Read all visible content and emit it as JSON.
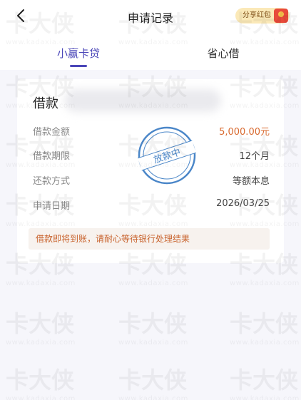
{
  "header": {
    "title": "申请记录",
    "share_label": "分享红包"
  },
  "tabs": [
    {
      "label": "小赢卡贷",
      "active": true
    },
    {
      "label": "省心借",
      "active": false
    }
  ],
  "card": {
    "title": "借款",
    "rows": [
      {
        "label": "借款金额",
        "value": "5,000.00元"
      },
      {
        "label": "借款期限",
        "value": "12个月"
      },
      {
        "label": "还款方式",
        "value": "等额本息"
      },
      {
        "label": "申请日期",
        "value": "2026/03/25"
      }
    ],
    "stamp_text": "放款中",
    "notice": "借款即将到账，请耐心等待银行处理结果"
  },
  "watermark": {
    "brand": "卡大侠",
    "url": "www.kadaxia.com"
  },
  "colors": {
    "accent": "#4a46b8",
    "amount": "#d8692e",
    "stamp": "#4a86c8"
  }
}
